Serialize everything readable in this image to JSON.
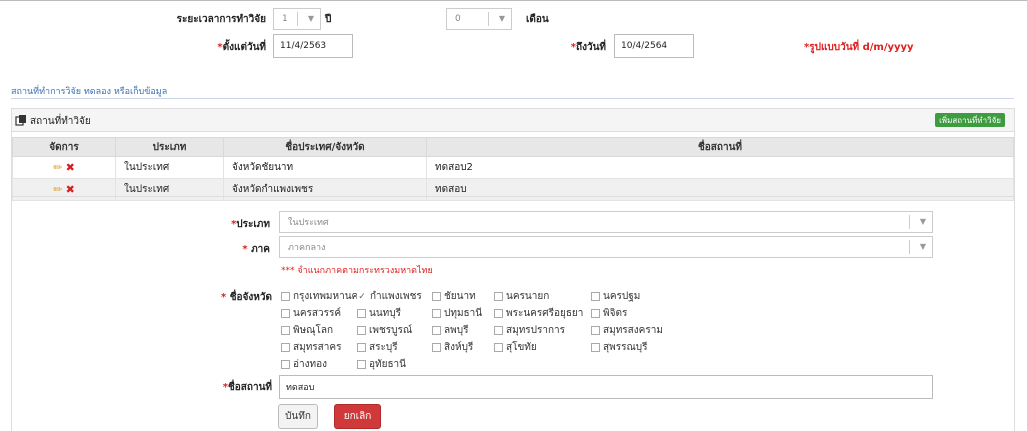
{
  "duration": {
    "label": "ระยะเวลาการทำวิจัย",
    "years_value": "1",
    "years_unit": "ปี",
    "months_value": "0",
    "months_unit": "เดือน"
  },
  "dates": {
    "from_label": "ตั้งแต่วันที่",
    "from_value": "11/4/2563",
    "to_label": "ถึงวันที่",
    "to_value": "10/4/2564",
    "format_hint": "รูปแบบวันที่ d/m/yyyy",
    "required_mark": "*"
  },
  "section_title": "สถานที่ทำการวิจัย ทดลอง หรือเก็บข้อมูล",
  "panel": {
    "title": "สถานที่ทำวิจัย",
    "add_button": "เพิ่มสถานที่ทำวิจัย"
  },
  "table": {
    "headers": [
      "จัดการ",
      "ประเภท",
      "ชื่อประเทศ/จังหวัด",
      "ชื่อสถานที่"
    ],
    "rows": [
      {
        "type": "ในประเทศ",
        "province": "จังหวัดชัยนาท",
        "place": "ทดสอบ2"
      },
      {
        "type": "ในประเทศ",
        "province": "จังหวัดกำแพงเพชร",
        "place": "ทดสอบ"
      }
    ]
  },
  "form": {
    "type_label": "ประเภท",
    "type_value": "ในประเทศ",
    "region_label": " ภาค",
    "region_value": "ภาคกลาง",
    "region_note": "*** จำแนกภาคตามกระทรวงมหาดไทย",
    "province_label": " ชื่อจังหวัด",
    "provinces": [
      {
        "name": "กรุงเทพมหานคร",
        "checked": false
      },
      {
        "name": "กำแพงเพชร",
        "checked": true
      },
      {
        "name": "ชัยนาท",
        "checked": false
      },
      {
        "name": "นครนายก",
        "checked": false
      },
      {
        "name": "นครปฐม",
        "checked": false
      },
      {
        "name": "นครสวรรค์",
        "checked": false
      },
      {
        "name": "นนทบุรี",
        "checked": false
      },
      {
        "name": "ปทุมธานี",
        "checked": false
      },
      {
        "name": "พระนครศรีอยุธยา",
        "checked": false
      },
      {
        "name": "พิจิตร",
        "checked": false
      },
      {
        "name": "พิษณุโลก",
        "checked": false
      },
      {
        "name": "เพชรบูรณ์",
        "checked": false
      },
      {
        "name": "ลพบุรี",
        "checked": false
      },
      {
        "name": "สมุทรปราการ",
        "checked": false
      },
      {
        "name": "สมุทรสงคราม",
        "checked": false
      },
      {
        "name": "สมุทรสาคร",
        "checked": false
      },
      {
        "name": "สระบุรี",
        "checked": false
      },
      {
        "name": "สิงห์บุรี",
        "checked": false
      },
      {
        "name": "สุโขทัย",
        "checked": false
      },
      {
        "name": "สุพรรณบุรี",
        "checked": false
      },
      {
        "name": "อ่างทอง",
        "checked": false
      },
      {
        "name": "อุทัยธานี",
        "checked": false
      }
    ],
    "place_label": "ชื่อสถานที่",
    "place_value": "ทดสอบ",
    "save_button": "บันทึก",
    "cancel_button": "ยกเลิก"
  },
  "colors": {
    "link_blue": "#3a6fb0",
    "required_red": "#e02020",
    "add_green": "#3d9c3f",
    "cancel_red": "#d0393a"
  }
}
